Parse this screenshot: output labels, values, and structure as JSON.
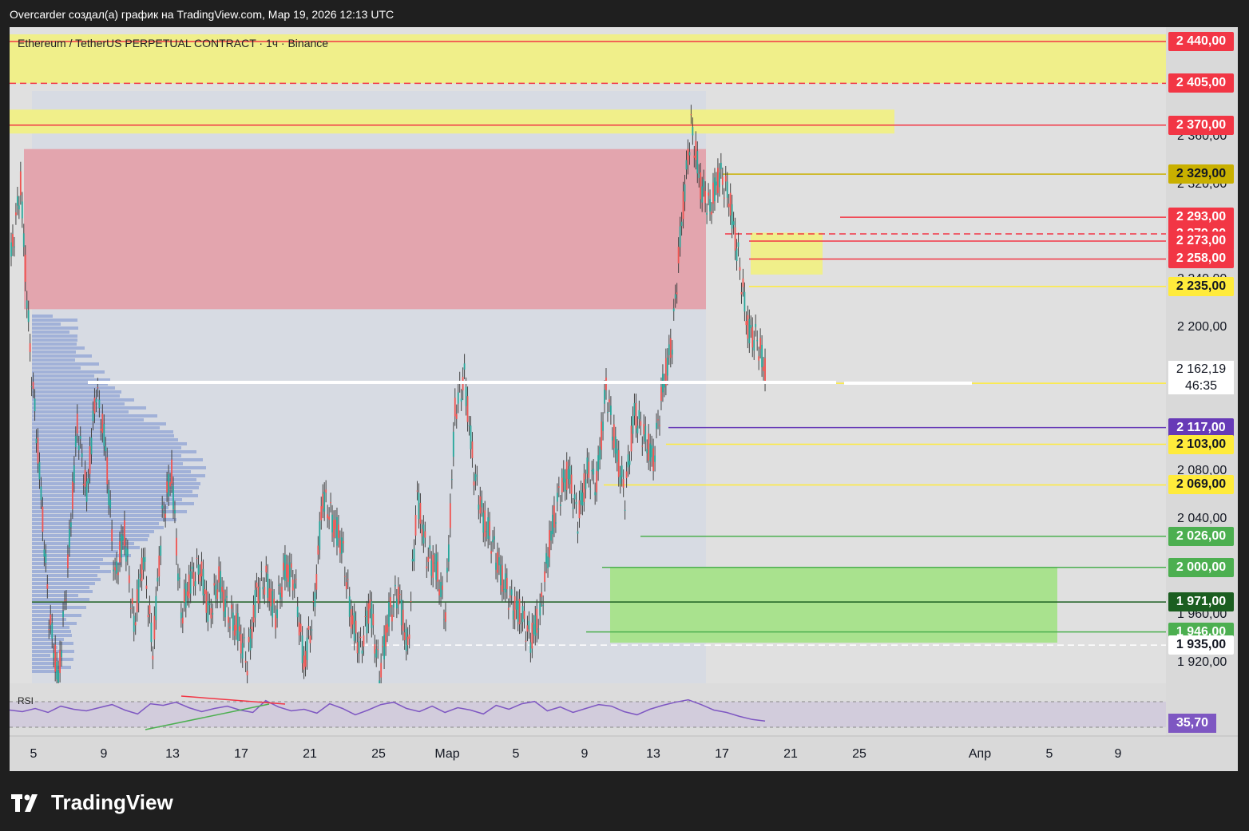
{
  "header": {
    "text": "Overcarder создал(а) график на TradingView.com, Мар 19, 2026 12:13 UTC"
  },
  "symbol": {
    "text": "Ethereum / TetherUS PERPETUAL CONTRACT · 1ч · Binance"
  },
  "brand": {
    "text": "TradingView",
    "icon": "tradingview-logo-icon"
  },
  "rsi": {
    "label": "RSI",
    "value": "35,70",
    "color": "#7e57c2"
  },
  "current": {
    "price": "2 162,19",
    "countdown": "46:35"
  },
  "chart_data": {
    "type": "candlestick",
    "timeframe": "1h",
    "ylim": [
      1903,
      2452
    ],
    "x_ticks": [
      "5",
      "9",
      "13",
      "17",
      "21",
      "25",
      "Мар",
      "5",
      "9",
      "13",
      "17",
      "21",
      "25",
      "Апр",
      "5",
      "9"
    ],
    "y_ticks": [
      "2 360,00",
      "2 320,00",
      "2 280,00",
      "2 240,00",
      "2 200,00",
      "2 080,00",
      "2 040,00",
      "1 960,00",
      "1 920,00"
    ],
    "levels": [
      {
        "price": 2440,
        "label": "2 440,00",
        "color": "#f23645",
        "style": "solid"
      },
      {
        "price": 2405,
        "label": "2 405,00",
        "color": "#f23645",
        "style": "dashed"
      },
      {
        "price": 2370,
        "label": "2 370,00",
        "color": "#f23645",
        "style": "solid"
      },
      {
        "price": 2329,
        "label": "2 329,00",
        "color": "#c9b000",
        "style": "solid"
      },
      {
        "price": 2293,
        "label": "2 293,00",
        "color": "#f23645",
        "style": "solid"
      },
      {
        "price": 2279,
        "label": "2 279,00",
        "color": "#f23645",
        "style": "dashed"
      },
      {
        "price": 2273,
        "label": "2 273,00",
        "color": "#f23645",
        "style": "solid"
      },
      {
        "price": 2258,
        "label": "2 258,00",
        "color": "#f23645",
        "style": "solid"
      },
      {
        "price": 2235,
        "label": "2 235,00",
        "color": "#ffeb3b",
        "style": "solid"
      },
      {
        "price": 2154,
        "label": "2 154,00",
        "color": "#ffeb3b",
        "style": "solid"
      },
      {
        "price": 2117,
        "label": "2 117,00",
        "color": "#673ab7",
        "style": "solid"
      },
      {
        "price": 2103,
        "label": "2 103,00",
        "color": "#ffeb3b",
        "style": "solid"
      },
      {
        "price": 2069,
        "label": "2 069,00",
        "color": "#ffeb3b",
        "style": "solid"
      },
      {
        "price": 2026,
        "label": "2 026,00",
        "color": "#4caf50",
        "style": "solid"
      },
      {
        "price": 2000,
        "label": "2 000,00",
        "color": "#4caf50",
        "style": "solid"
      },
      {
        "price": 1971,
        "label": "1 971,00",
        "color": "#1b5e20",
        "style": "solid"
      },
      {
        "price": 1946,
        "label": "1 946,00",
        "color": "#4caf50",
        "style": "solid"
      },
      {
        "price": 1935,
        "label": "1 935,00",
        "color": "#ffffff",
        "style": "dashed"
      }
    ],
    "zones": [
      {
        "name": "supply-zone-upper",
        "from": 2405,
        "to": 2446,
        "color": "#f0ef8a"
      },
      {
        "name": "supply-zone-mid",
        "from": 2363,
        "to": 2383,
        "color": "#f0ef8a"
      },
      {
        "name": "resistance-zone",
        "from": 2216,
        "to": 2350,
        "color": "#e3a5ae"
      },
      {
        "name": "demand-zone",
        "from": 1937,
        "to": 2000,
        "color": "#a9e28e"
      },
      {
        "name": "small-zone",
        "from": 2245,
        "to": 2280,
        "color": "#f0ef8a"
      }
    ],
    "price_path": [
      [
        0,
        2260
      ],
      [
        1,
        2320
      ],
      [
        2,
        2180
      ],
      [
        3,
        2080
      ],
      [
        4,
        1960
      ],
      [
        5,
        1905
      ],
      [
        6,
        2000
      ],
      [
        7,
        2120
      ],
      [
        8,
        2060
      ],
      [
        9,
        2150
      ],
      [
        10,
        2100
      ],
      [
        11,
        1990
      ],
      [
        12,
        2030
      ],
      [
        13,
        1950
      ],
      [
        14,
        2010
      ],
      [
        15,
        1930
      ],
      [
        16,
        2040
      ],
      [
        17,
        2080
      ],
      [
        18,
        1960
      ],
      [
        19,
        1990
      ],
      [
        20,
        2000
      ],
      [
        21,
        1960
      ],
      [
        22,
        1990
      ],
      [
        23,
        1960
      ],
      [
        24,
        1950
      ],
      [
        25,
        1920
      ],
      [
        26,
        1980
      ],
      [
        27,
        1990
      ],
      [
        28,
        1960
      ],
      [
        29,
        2000
      ],
      [
        30,
        1990
      ],
      [
        31,
        1920
      ],
      [
        32,
        1960
      ],
      [
        33,
        2060
      ],
      [
        34,
        2040
      ],
      [
        35,
        2020
      ],
      [
        36,
        1960
      ],
      [
        37,
        1930
      ],
      [
        38,
        1970
      ],
      [
        39,
        1910
      ],
      [
        40,
        1960
      ],
      [
        41,
        1980
      ],
      [
        42,
        1930
      ],
      [
        43,
        2060
      ],
      [
        44,
        2010
      ],
      [
        45,
        2000
      ],
      [
        46,
        1960
      ],
      [
        47,
        2130
      ],
      [
        48,
        2160
      ],
      [
        49,
        2080
      ],
      [
        50,
        2040
      ],
      [
        51,
        2020
      ],
      [
        52,
        1990
      ],
      [
        53,
        1970
      ],
      [
        54,
        1960
      ],
      [
        55,
        1940
      ],
      [
        56,
        1960
      ],
      [
        57,
        2020
      ],
      [
        58,
        2060
      ],
      [
        59,
        2080
      ],
      [
        60,
        2040
      ],
      [
        61,
        2080
      ],
      [
        62,
        2070
      ],
      [
        63,
        2150
      ],
      [
        64,
        2100
      ],
      [
        65,
        2060
      ],
      [
        66,
        2130
      ],
      [
        67,
        2110
      ],
      [
        68,
        2090
      ],
      [
        69,
        2150
      ],
      [
        70,
        2190
      ],
      [
        71,
        2290
      ],
      [
        72,
        2370
      ],
      [
        73,
        2320
      ],
      [
        74,
        2300
      ],
      [
        75,
        2330
      ],
      [
        76,
        2310
      ],
      [
        77,
        2260
      ],
      [
        78,
        2200
      ],
      [
        79,
        2190
      ],
      [
        80,
        2160
      ]
    ],
    "price_x_range": [
      0,
      80
    ],
    "rsi_path": [
      50,
      48,
      52,
      47,
      55,
      51,
      49,
      53,
      57,
      50,
      45,
      58,
      56,
      60,
      53,
      48,
      52,
      55,
      50,
      47,
      62,
      54,
      49,
      51,
      46,
      58,
      52,
      44,
      50,
      57,
      60,
      52,
      48,
      55,
      47,
      53,
      50,
      45,
      56,
      51,
      58,
      61,
      49,
      54,
      47,
      52,
      57,
      55,
      48,
      44,
      51,
      56,
      60,
      63,
      57,
      50,
      47,
      42,
      38,
      36
    ],
    "rsi_range": [
      20,
      80
    ]
  }
}
